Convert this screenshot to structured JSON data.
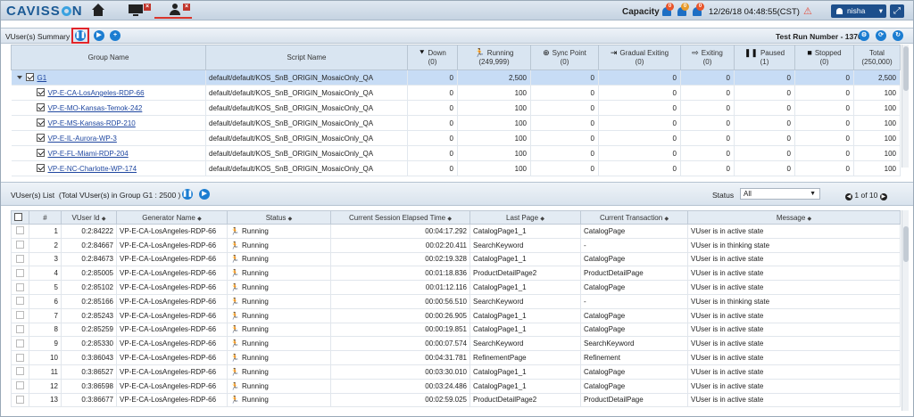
{
  "topbar": {
    "logo_left": "CAVISS",
    "logo_right": "N",
    "capacity_label": "Capacity",
    "alerts": [
      {
        "count": "0",
        "color": "#e8552b"
      },
      {
        "count": "0",
        "color": "#e8552b"
      },
      {
        "count": "0",
        "color": "#e8552b"
      }
    ],
    "datetime": "12/26/18 04:48:55(CST)",
    "user": "nisha",
    "colors": {
      "accent": "#1d4f8c",
      "alert": "#d9342b"
    }
  },
  "summary": {
    "title": "VUser(s) Summary",
    "test_run": "Test Run Number - 1370",
    "columns": [
      {
        "label": "Group Name",
        "sub": ""
      },
      {
        "label": "Script Name",
        "sub": ""
      },
      {
        "label": "Down",
        "sub": "(0)",
        "icon": "down-arrow-icon"
      },
      {
        "label": "Running",
        "sub": "(249,999)",
        "icon": "running-icon"
      },
      {
        "label": "Sync Point",
        "sub": "(0)",
        "icon": "sync-icon"
      },
      {
        "label": "Gradual Exiting",
        "sub": "(0)",
        "icon": "gradual-exit-icon"
      },
      {
        "label": "Exiting",
        "sub": "(0)",
        "icon": "exit-icon"
      },
      {
        "label": "Paused",
        "sub": "(1)",
        "icon": "pause-icon"
      },
      {
        "label": "Stopped",
        "sub": "(0)",
        "icon": "stop-icon"
      },
      {
        "label": "Total",
        "sub": "(250,000)"
      }
    ],
    "rows": [
      {
        "name": "G1",
        "script": "default/default/KOS_SnB_ORIGIN_MosaicOnly_QA",
        "down": "0",
        "running": "2,500",
        "sync": "0",
        "gradual": "0",
        "exiting": "0",
        "paused": "0",
        "stopped": "0",
        "total": "2,500",
        "group": true
      },
      {
        "name": "VP-E-CA-LosAngeles-RDP-66",
        "script": "default/default/KOS_SnB_ORIGIN_MosaicOnly_QA",
        "down": "0",
        "running": "100",
        "sync": "0",
        "gradual": "0",
        "exiting": "0",
        "paused": "0",
        "stopped": "0",
        "total": "100"
      },
      {
        "name": "VP-E-MO-Kansas-Temok-242",
        "script": "default/default/KOS_SnB_ORIGIN_MosaicOnly_QA",
        "down": "0",
        "running": "100",
        "sync": "0",
        "gradual": "0",
        "exiting": "0",
        "paused": "0",
        "stopped": "0",
        "total": "100"
      },
      {
        "name": "VP-E-MS-Kansas-RDP-210",
        "script": "default/default/KOS_SnB_ORIGIN_MosaicOnly_QA",
        "down": "0",
        "running": "100",
        "sync": "0",
        "gradual": "0",
        "exiting": "0",
        "paused": "0",
        "stopped": "0",
        "total": "100"
      },
      {
        "name": "VP-E-IL-Aurora-WP-3",
        "script": "default/default/KOS_SnB_ORIGIN_MosaicOnly_QA",
        "down": "0",
        "running": "100",
        "sync": "0",
        "gradual": "0",
        "exiting": "0",
        "paused": "0",
        "stopped": "0",
        "total": "100"
      },
      {
        "name": "VP-E-FL-Miami-RDP-204",
        "script": "default/default/KOS_SnB_ORIGIN_MosaicOnly_QA",
        "down": "0",
        "running": "100",
        "sync": "0",
        "gradual": "0",
        "exiting": "0",
        "paused": "0",
        "stopped": "0",
        "total": "100"
      },
      {
        "name": "VP-E-NC-Charlotte-WP-174",
        "script": "default/default/KOS_SnB_ORIGIN_MosaicOnly_QA",
        "down": "0",
        "running": "100",
        "sync": "0",
        "gradual": "0",
        "exiting": "0",
        "paused": "0",
        "stopped": "0",
        "total": "100"
      }
    ]
  },
  "list": {
    "title": "VUser(s) List",
    "subtitle": "(Total VUser(s) in Group G1 : 2500 )",
    "status_label": "Status",
    "status_value": "All",
    "page_info": "1 of 10",
    "columns": [
      "#",
      "VUser Id",
      "Generator Name",
      "Status",
      "Current Session Elapsed Time",
      "Last Page",
      "Current Transaction",
      "Message"
    ],
    "rows": [
      {
        "n": "1",
        "id": "0:2:84222",
        "gen": "VP-E-CA-LosAngeles-RDP-66",
        "status": "Running",
        "elapsed": "00:04:17.292",
        "page": "CatalogPage1_1",
        "tx": "CatalogPage",
        "msg": "VUser is in active state"
      },
      {
        "n": "2",
        "id": "0:2:84667",
        "gen": "VP-E-CA-LosAngeles-RDP-66",
        "status": "Running",
        "elapsed": "00:02:20.411",
        "page": "SearchKeyword",
        "tx": "-",
        "msg": "VUser is in thinking state"
      },
      {
        "n": "3",
        "id": "0:2:84673",
        "gen": "VP-E-CA-LosAngeles-RDP-66",
        "status": "Running",
        "elapsed": "00:02:19.328",
        "page": "CatalogPage1_1",
        "tx": "CatalogPage",
        "msg": "VUser is in active state"
      },
      {
        "n": "4",
        "id": "0:2:85005",
        "gen": "VP-E-CA-LosAngeles-RDP-66",
        "status": "Running",
        "elapsed": "00:01:18.836",
        "page": "ProductDetailPage2",
        "tx": "ProductDetailPage",
        "msg": "VUser is in active state"
      },
      {
        "n": "5",
        "id": "0:2:85102",
        "gen": "VP-E-CA-LosAngeles-RDP-66",
        "status": "Running",
        "elapsed": "00:01:12.116",
        "page": "CatalogPage1_1",
        "tx": "CatalogPage",
        "msg": "VUser is in active state"
      },
      {
        "n": "6",
        "id": "0:2:85166",
        "gen": "VP-E-CA-LosAngeles-RDP-66",
        "status": "Running",
        "elapsed": "00:00:56.510",
        "page": "SearchKeyword",
        "tx": "-",
        "msg": "VUser is in thinking state"
      },
      {
        "n": "7",
        "id": "0:2:85243",
        "gen": "VP-E-CA-LosAngeles-RDP-66",
        "status": "Running",
        "elapsed": "00:00:26.905",
        "page": "CatalogPage1_1",
        "tx": "CatalogPage",
        "msg": "VUser is in active state"
      },
      {
        "n": "8",
        "id": "0:2:85259",
        "gen": "VP-E-CA-LosAngeles-RDP-66",
        "status": "Running",
        "elapsed": "00:00:19.851",
        "page": "CatalogPage1_1",
        "tx": "CatalogPage",
        "msg": "VUser is in active state"
      },
      {
        "n": "9",
        "id": "0:2:85330",
        "gen": "VP-E-CA-LosAngeles-RDP-66",
        "status": "Running",
        "elapsed": "00:00:07.574",
        "page": "SearchKeyword",
        "tx": "SearchKeyword",
        "msg": "VUser is in active state"
      },
      {
        "n": "10",
        "id": "0:3:86043",
        "gen": "VP-E-CA-LosAngeles-RDP-66",
        "status": "Running",
        "elapsed": "00:04:31.781",
        "page": "RefinementPage",
        "tx": "Refinement",
        "msg": "VUser is in active state"
      },
      {
        "n": "11",
        "id": "0:3:86527",
        "gen": "VP-E-CA-LosAngeles-RDP-66",
        "status": "Running",
        "elapsed": "00:03:30.010",
        "page": "CatalogPage1_1",
        "tx": "CatalogPage",
        "msg": "VUser is in active state"
      },
      {
        "n": "12",
        "id": "0:3:86598",
        "gen": "VP-E-CA-LosAngeles-RDP-66",
        "status": "Running",
        "elapsed": "00:03:24.486",
        "page": "CatalogPage1_1",
        "tx": "CatalogPage",
        "msg": "VUser is in active state"
      },
      {
        "n": "13",
        "id": "0:3:86677",
        "gen": "VP-E-CA-LosAngeles-RDP-66",
        "status": "Running",
        "elapsed": "00:02:59.025",
        "page": "ProductDetailPage2",
        "tx": "ProductDetailPage",
        "msg": "VUser is in active state"
      }
    ]
  }
}
